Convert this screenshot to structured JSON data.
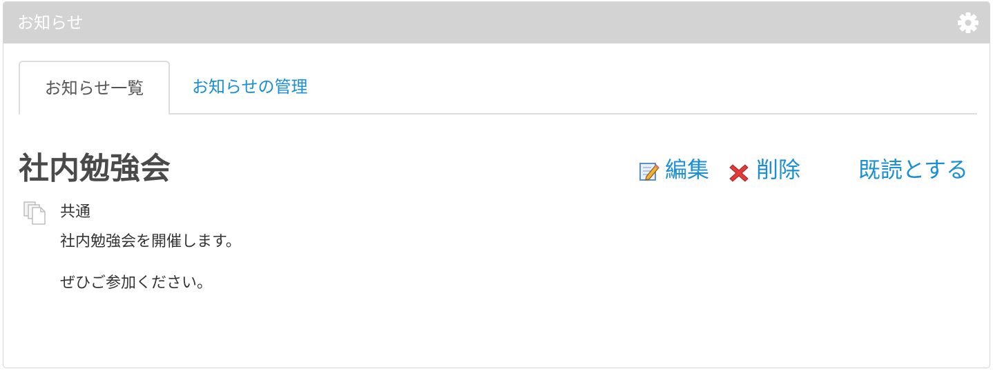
{
  "panel": {
    "title": "お知らせ",
    "settings_icon": "gear-icon"
  },
  "tabs": {
    "active_label": "お知らせ一覧",
    "manage_label": "お知らせの管理"
  },
  "notice": {
    "title": "社内勉強会",
    "category": "共通",
    "body": [
      "社内勉強会を開催します。",
      "ぜひご参加ください。"
    ]
  },
  "actions": {
    "edit_label": "編集",
    "delete_label": "削除",
    "mark_read_label": "既読とする",
    "edit_icon": "edit-pencil-icon",
    "delete_icon": "delete-x-icon"
  },
  "colors": {
    "header_bg": "#d3d3d3",
    "link": "#1a8fd6",
    "text": "#333333"
  }
}
